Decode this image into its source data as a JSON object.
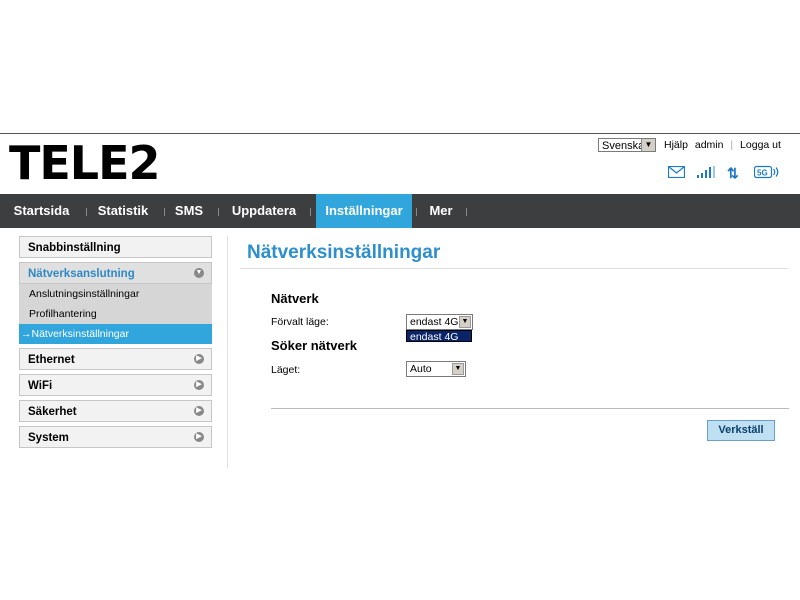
{
  "brand": {
    "logo": "TELE2"
  },
  "header": {
    "language": "Svenska",
    "links": [
      "Hjälp",
      "admin",
      "Logga ut"
    ],
    "status_icons": [
      "mail-icon",
      "signal-icon",
      "data-transfer-icon",
      "network-5g-icon"
    ],
    "network_badge": "5G"
  },
  "nav": {
    "items": [
      "Startsida",
      "Statistik",
      "SMS",
      "Uppdatera",
      "Inställningar",
      "Mer"
    ],
    "active": "Inställningar"
  },
  "sidebar": {
    "groups": [
      {
        "label": "Snabbinställning"
      },
      {
        "label": "Nätverksanslutning",
        "subitems": [
          "Anslutningsinställningar",
          "Profilhantering",
          "→Nätverksinställningar"
        ]
      },
      {
        "label": "Ethernet"
      },
      {
        "label": "WiFi"
      },
      {
        "label": "Säkerhet"
      },
      {
        "label": "System"
      }
    ]
  },
  "main": {
    "title": "Nätverksinställningar",
    "network": {
      "heading": "Nätverk",
      "mode_label": "Förvalt läge:",
      "mode_value": "endast 4G",
      "mode_open_option": "endast 4G"
    },
    "search": {
      "heading": "Söker nätverk",
      "mode_label": "Läget:",
      "mode_value": "Auto"
    },
    "apply_label": "Verkställ"
  },
  "colors": {
    "accent": "#31a6dd",
    "nav_bg": "#3d3e40",
    "title": "#2e8fcd"
  }
}
